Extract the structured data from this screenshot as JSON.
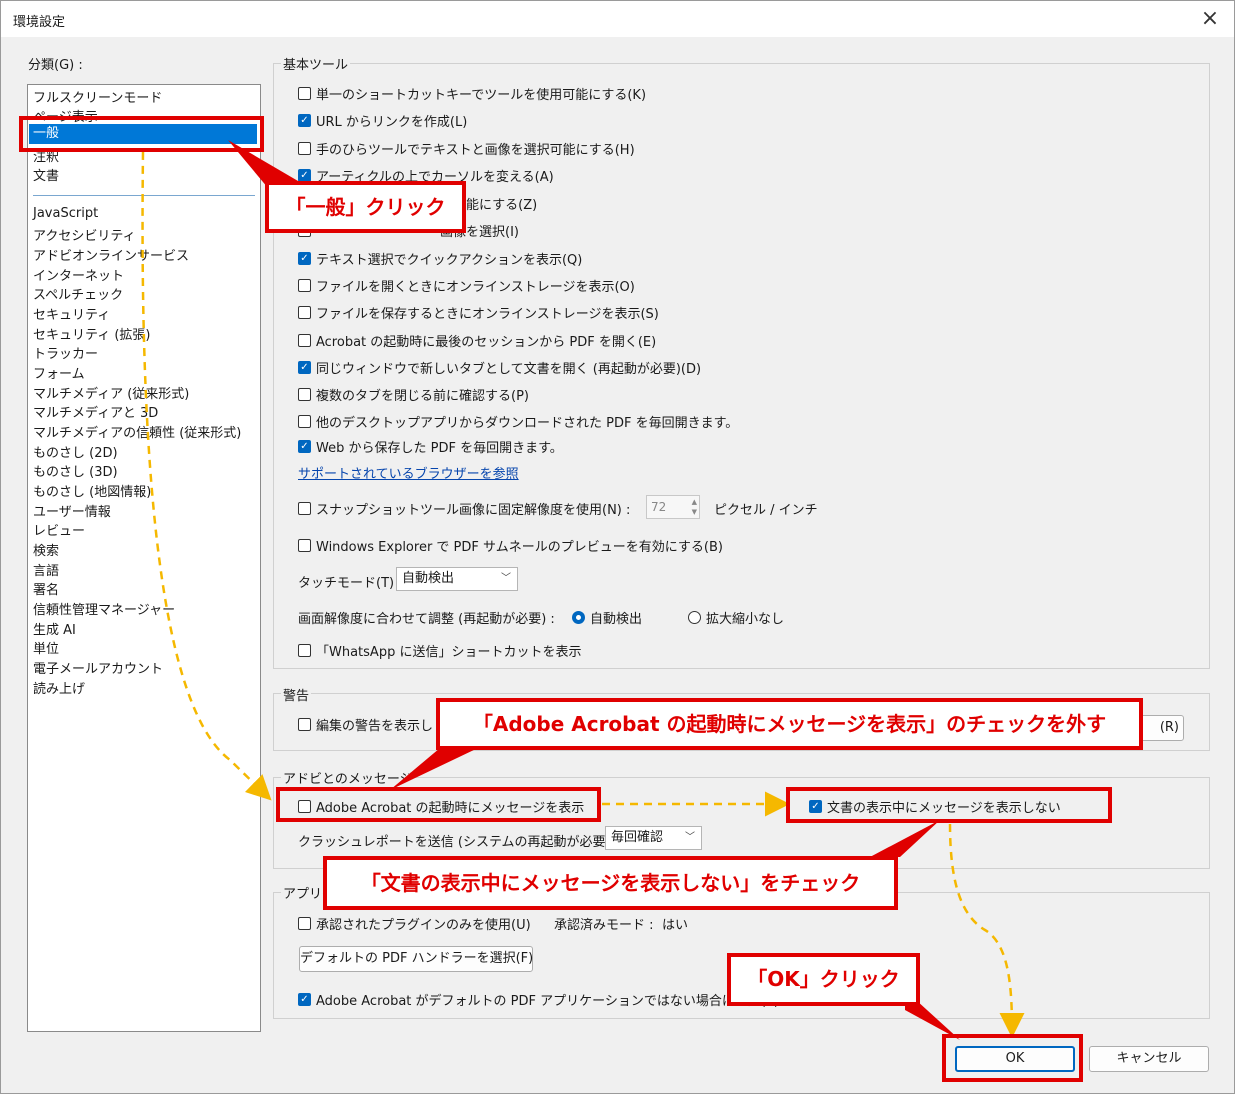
{
  "window": {
    "title": "環境設定",
    "close_icon": "×"
  },
  "categories": {
    "label": "分類(G) :",
    "top_items": [
      "フルスクリーンモード",
      "ページ表示",
      "一般",
      "注釈",
      "文書"
    ],
    "selected": "一般",
    "items": [
      "JavaScript",
      "アクセシビリティ",
      "アドビオンラインサービス",
      "インターネット",
      "スペルチェック",
      "セキュリティ",
      "セキュリティ (拡張)",
      "トラッカー",
      "フォーム",
      "マルチメディア (従来形式)",
      "マルチメディアと 3D",
      "マルチメディアの信頼性 (従来形式)",
      "ものさし (2D)",
      "ものさし (3D)",
      "ものさし (地図情報)",
      "ユーザー情報",
      "レビュー",
      "検索",
      "言語",
      "署名",
      "信頼性管理マネージャー",
      "生成 AI",
      "単位",
      "電子メールアカウント",
      "読み上げ"
    ]
  },
  "basic_tools": {
    "title": "基本ツール",
    "options": [
      {
        "label": "単一のショートカットキーでツールを使用可能にする(K)",
        "checked": false
      },
      {
        "label": "URL からリンクを作成(L)",
        "checked": true
      },
      {
        "label": "手のひらツールでテキストと画像を選択可能にする(H)",
        "checked": false
      },
      {
        "label": "アーティクルの上でカーソルを変える(A)",
        "checked": true
      },
      {
        "label": "能にする(Z)",
        "checked": false
      },
      {
        "label": "画像を選択(I)",
        "checked": false
      },
      {
        "label": "テキスト選択でクイックアクションを表示(Q)",
        "checked": true
      },
      {
        "label": "ファイルを開くときにオンラインストレージを表示(O)",
        "checked": false
      },
      {
        "label": "ファイルを保存するときにオンラインストレージを表示(S)",
        "checked": false
      },
      {
        "label": "Acrobat の起動時に最後のセッションから PDF を開く(E)",
        "checked": false
      },
      {
        "label": "同じウィンドウで新しいタブとして文書を開く (再起動が必要)(D)",
        "checked": true
      },
      {
        "label": "複数のタブを閉じる前に確認する(P)",
        "checked": false
      },
      {
        "label": "他のデスクトップアプリからダウンロードされた PDF を毎回開きます。",
        "checked": false
      },
      {
        "label": "Web から保存した PDF を毎回開きます。",
        "checked": true
      }
    ],
    "browser_link": "サポートされているブラウザーを参照",
    "snapshot_label": "スナップショットツール画像に固定解像度を使用(N) :",
    "snapshot_value": "72",
    "snapshot_unit": "ピクセル / インチ",
    "windows_explorer_label": "Windows Explorer で PDF サムネールのプレビューを有効にする(B)",
    "touch_mode_label": "タッチモード(T) :",
    "touch_mode_value": "自動検出",
    "scale_label": "画面解像度に合わせて調整 (再起動が必要) :",
    "scale_auto": "自動検出",
    "scale_none": "拡大縮小なし",
    "whatsapp_label": "「WhatsApp に送信」ショートカットを表示"
  },
  "warnings": {
    "title": "警告",
    "option_label": "編集の警告を表示し",
    "reset_button": "(R)"
  },
  "adobe_messages": {
    "title": "アドビとのメッセージ",
    "startup_label": "Adobe Acrobat の起動時にメッセージを表示",
    "startup_checked": false,
    "viewing_label": "文書の表示中にメッセージを表示しない",
    "viewing_checked": true,
    "crash_label": "クラッシュレポートを送信 (システムの再起動が必要):",
    "crash_value": "毎回確認"
  },
  "app_startup": {
    "title": "アプリケ",
    "plugins_label": "承認されたプラグインのみを使用(U)",
    "mode_label": "承認済みモード :",
    "mode_value": "はい",
    "default_handler_button": "デフォルトの PDF ハンドラーを選択(F)",
    "notify_label": "Adobe Acrobat がデフォルトの PDF アプリケーションではない場合に通知(T)"
  },
  "footer": {
    "ok": "OK",
    "cancel": "キャンセル"
  },
  "callouts": {
    "general": "「一般」クリック",
    "uncheck": "「Adobe Acrobat の起動時にメッセージを表示」のチェックを外す",
    "check": "「文書の表示中にメッセージを表示しない」をチェック",
    "ok": "「OK」クリック"
  },
  "colors": {
    "accent": "#0067c0",
    "selection": "#0078d7",
    "annotation": "#e00000",
    "arrow": "#f5b800"
  }
}
